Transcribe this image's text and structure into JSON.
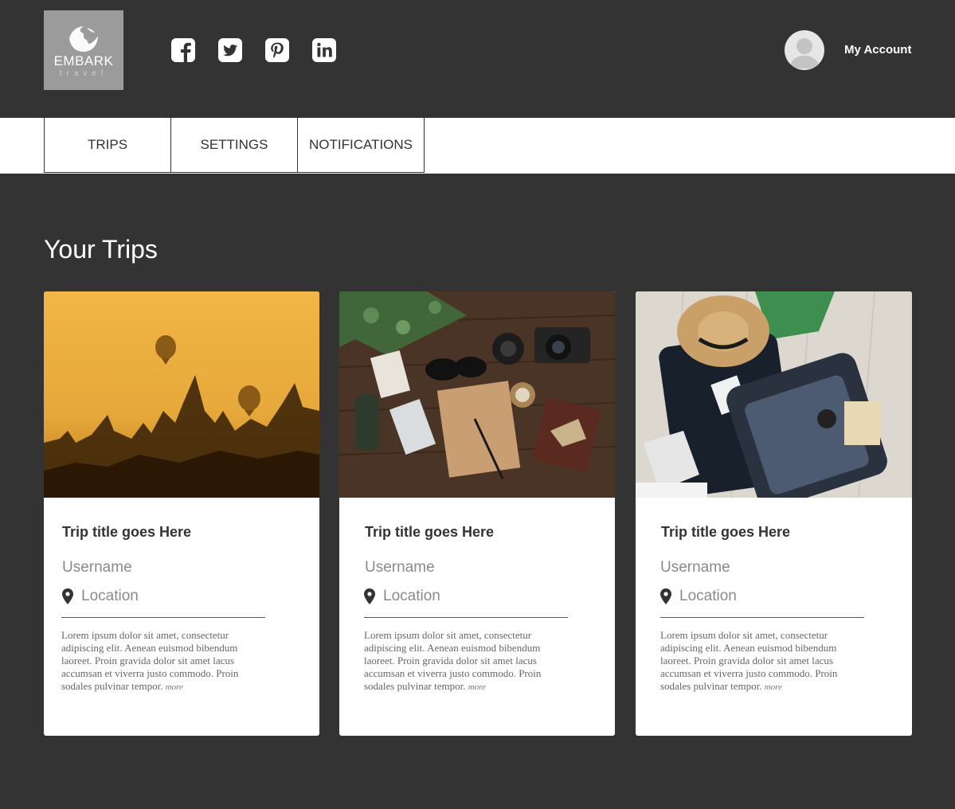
{
  "header": {
    "logo": {
      "brand": "EMBARK",
      "sub": "travel"
    },
    "social": [
      {
        "name": "facebook-icon"
      },
      {
        "name": "twitter-icon"
      },
      {
        "name": "pinterest-icon"
      },
      {
        "name": "linkedin-icon"
      }
    ],
    "account_label": "My Account"
  },
  "nav": {
    "tabs": [
      {
        "label": "TRIPS"
      },
      {
        "label": "SETTINGS"
      },
      {
        "label": "NOTIFICATIONS"
      }
    ]
  },
  "main": {
    "title": "Your Trips",
    "cards": [
      {
        "image": "balloons-temples-sunset",
        "title": "Trip title goes Here",
        "username": "Username",
        "location": "Location",
        "description": "Lorem ipsum dolor sit amet, consectetur adipiscing elit. Aenean euismod bibendum laoreet. Proin gravida dolor sit amet lacus accumsan et viverra justo commodo. Proin sodales pulvinar tempor.",
        "more": "more"
      },
      {
        "image": "travel-flatlay-camera-notebook",
        "title": "Trip title goes Here",
        "username": "Username",
        "location": "Location",
        "description": "Lorem ipsum dolor sit amet, consectetur adipiscing elit. Aenean euismod bibendum laoreet. Proin gravida dolor sit amet lacus accumsan et viverra justo commodo. Proin sodales pulvinar tempor.",
        "more": "more"
      },
      {
        "image": "packed-suitcase-hat",
        "title": "Trip title goes Here",
        "username": "Username",
        "location": "Location",
        "description": "Lorem ipsum dolor sit amet, consectetur adipiscing elit. Aenean euismod bibendum laoreet. Proin gravida dolor sit amet lacus accumsan et viverra justo commodo. Proin sodales pulvinar tempor.",
        "more": "more"
      }
    ]
  },
  "colors": {
    "background": "#333333",
    "card": "#ffffff",
    "logo_bg": "#9b9b9b",
    "text_dark": "#333333",
    "text_muted": "#8a8a8a"
  }
}
